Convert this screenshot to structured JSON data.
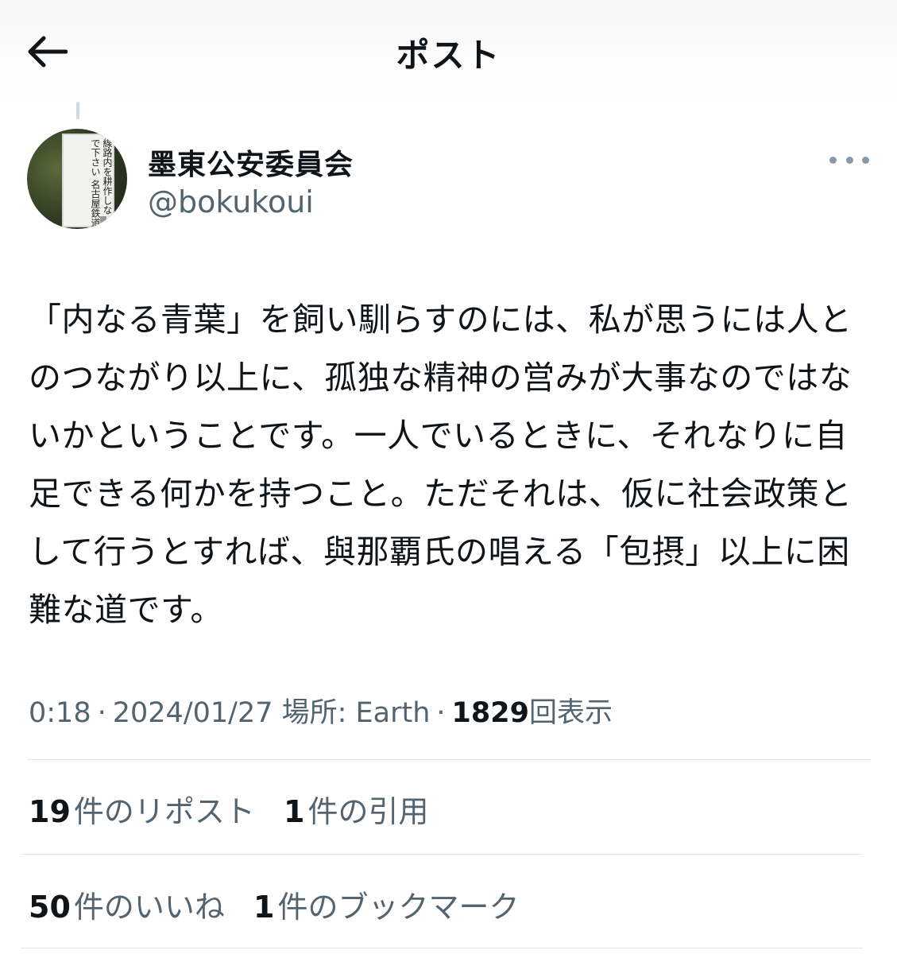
{
  "header": {
    "title": "ポスト",
    "back_icon": "arrow-left-icon"
  },
  "author": {
    "display_name": "墨東公安委員会",
    "handle": "@bokukoui",
    "avatar_sign_text": "線路内を耕作しないで下さい 名古屋鉄道"
  },
  "tweet": {
    "text": "「内なる青葉」を飼い馴らすのには、私が思うには人とのつながり以上に、孤独な精神の営みが大事なのではないかということです。一人でいるときに、それなりに自足できる何かを持つこと。ただそれは、仮に社会政策として行うとすれば、與那覇氏の唱える「包摂」以上に困難な道です。"
  },
  "meta": {
    "time": "0:18",
    "separator": "·",
    "date": "2024/01/27",
    "location": "場所: Earth",
    "views_count": "1829",
    "views_label": "回表示"
  },
  "stats": {
    "reposts_count": "19",
    "reposts_label": "件のリポスト",
    "quotes_count": "1",
    "quotes_label": "件の引用",
    "likes_count": "50",
    "likes_label": "件のいいね",
    "bookmarks_count": "1",
    "bookmarks_label": "件のブックマーク"
  },
  "colors": {
    "text": "#0f1419",
    "secondary": "#536471",
    "divider": "#e1e6ea"
  }
}
